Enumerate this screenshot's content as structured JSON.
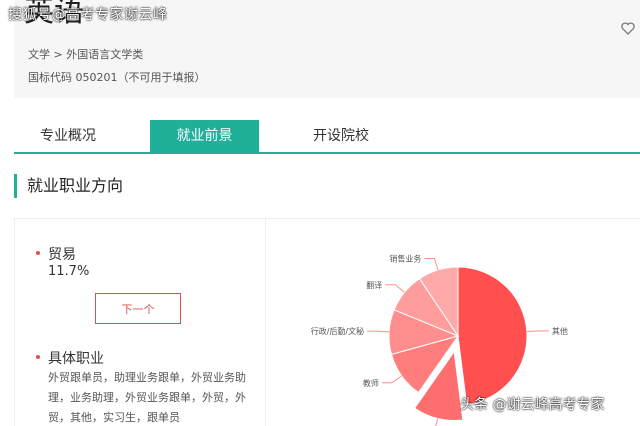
{
  "watermark_top": "搜狐号@高考专家谢云峰",
  "watermark_bottom": "头条 @谢云峰高考专家",
  "header": {
    "title": "英语",
    "breadcrumb": "文学 > 外国语言文学类",
    "code": "国标代码 050201（不可用于填报）"
  },
  "tabs": [
    {
      "label": "专业概况",
      "active": false
    },
    {
      "label": "就业前景",
      "active": true
    },
    {
      "label": "开设院校",
      "active": false
    }
  ],
  "section_title": "就业职业方向",
  "career": {
    "name": "贸易",
    "percent": "11.7%",
    "next_label": "下一个",
    "jobs_heading": "具体职业",
    "jobs_text": "外贸跟单员，助理业务跟单，外贸业务助理，业务助理，外贸业务跟单，外贸，外贸，其他，实习生，跟单员"
  },
  "colors": {
    "accent": "#20b09a",
    "highlight": "#e05050"
  },
  "chart_data": {
    "type": "pie",
    "slices": [
      {
        "label": "其他",
        "value": 48.0,
        "color": "#ff4f4f"
      },
      {
        "label": "贸易",
        "value": 11.7,
        "color": "#ff6e6e",
        "exploded": true
      },
      {
        "label": "教师",
        "value": 11.0,
        "color": "#ff7d7d"
      },
      {
        "label": "行政/后勤/文秘",
        "value": 10.5,
        "color": "#ff8e8e"
      },
      {
        "label": "翻译",
        "value": 9.4,
        "color": "#ff9c9c"
      },
      {
        "label": "销售业务",
        "value": 9.4,
        "color": "#ffaaaa"
      }
    ]
  }
}
